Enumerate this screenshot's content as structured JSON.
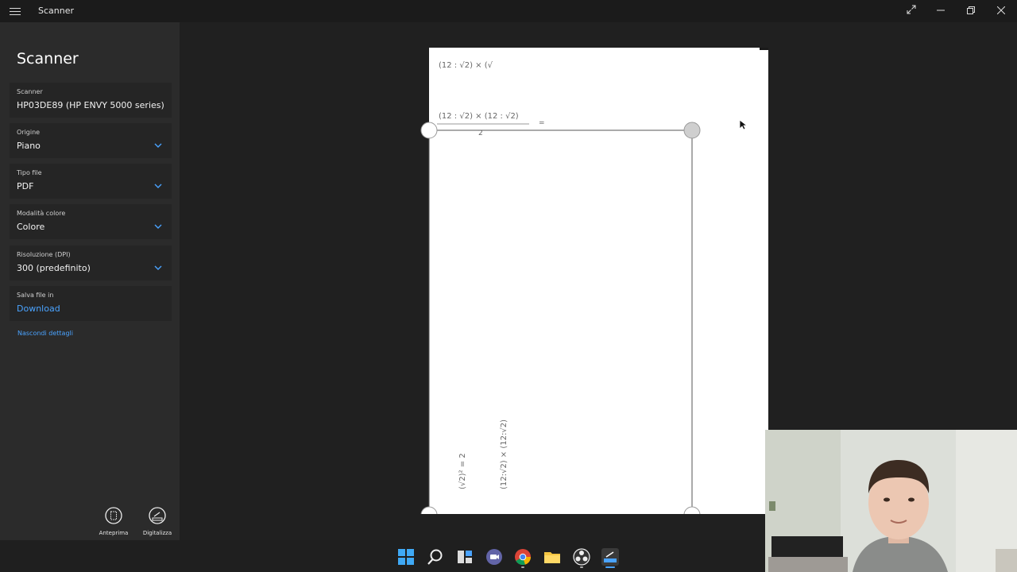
{
  "window": {
    "title": "Scanner"
  },
  "sidebar": {
    "heading": "Scanner",
    "fields": [
      {
        "label": "Scanner",
        "value": "HP03DE89 (HP ENVY 5000 series)",
        "dropdown": false
      },
      {
        "label": "Origine",
        "value": "Piano",
        "dropdown": true
      },
      {
        "label": "Tipo file",
        "value": "PDF",
        "dropdown": true
      },
      {
        "label": "Modalità colore",
        "value": "Colore",
        "dropdown": true
      },
      {
        "label": "Risoluzione (DPI)",
        "value": "300 (predefinito)",
        "dropdown": true
      },
      {
        "label": "Salva file in",
        "value": "Download",
        "dropdown": false
      }
    ],
    "hide_details": "Nascondi dettagli"
  },
  "actions": {
    "preview_label": "Anteprima",
    "scan_label": "Digitalizza"
  },
  "handwriting": {
    "line1": "(12 : √2) × (√",
    "line2": "(12 : √2) × (12 : √2)",
    "line2_denominator": "2",
    "line2_equals": "=",
    "rotated1": "(√2)² = 2",
    "rotated2": "(12:√2) × (12:√2)"
  },
  "taskbar": {
    "icons": [
      "windows-start-icon",
      "search-icon",
      "task-view-icon",
      "teams-icon",
      "chrome-icon",
      "file-explorer-icon",
      "obs-icon",
      "scanner-app-icon"
    ]
  },
  "colors": {
    "accent": "#4aa3ff",
    "background": "#202020",
    "sidebar": "#2b2b2b"
  }
}
